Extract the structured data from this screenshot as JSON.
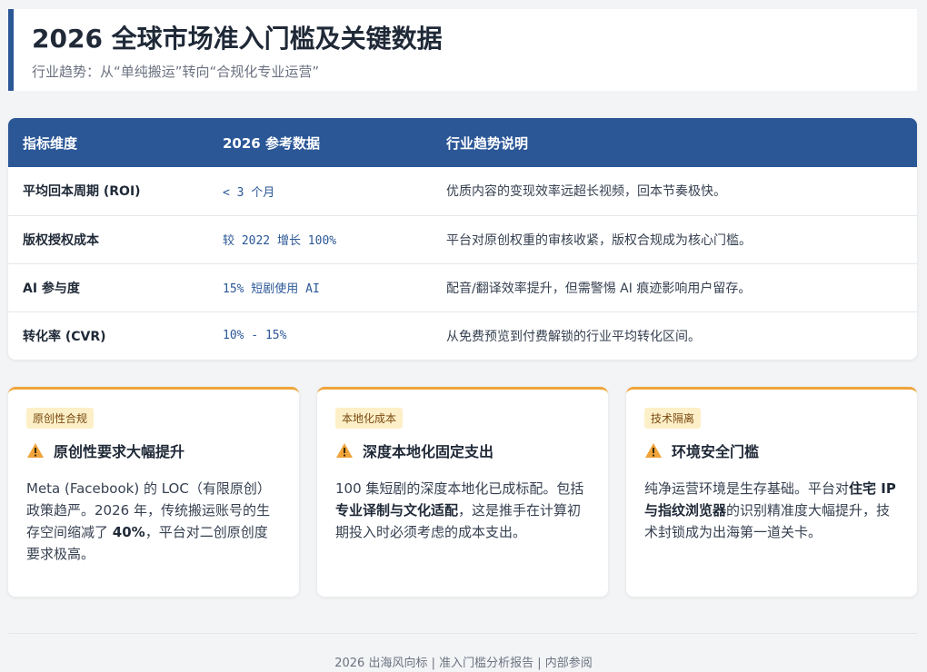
{
  "header": {
    "title": "2026 全球市场准入门槛及关键数据",
    "subtitle": "行业趋势：从“单纯搬运”转向“合规化专业运营”"
  },
  "table": {
    "headers": [
      "指标维度",
      "2026 参考数据",
      "行业趋势说明"
    ],
    "rows": [
      {
        "metric": "平均回本周期 (ROI)",
        "value": "< 3 个月",
        "desc": "优质内容的变现效率远超长视频，回本节奏极快。"
      },
      {
        "metric": "版权授权成本",
        "value": "较 2022 增长 100%",
        "desc": "平台对原创权重的审核收紧，版权合规成为核心门槛。"
      },
      {
        "metric": "AI 参与度",
        "value": "15% 短剧使用 AI",
        "desc": "配音/翻译效率提升，但需警惕 AI 痕迹影响用户留存。"
      },
      {
        "metric": "转化率 (CVR)",
        "value": "10% - 15%",
        "desc": "从免费预览到付费解锁的行业平均转化区间。"
      }
    ]
  },
  "cards": [
    {
      "tag": "原创性合规",
      "title": "原创性要求大幅提升",
      "body": [
        "Meta (Facebook) 的 LOC（有限原创）政策趋严。2026 年，传统搬运账号的生存空间缩减了 ",
        "40%",
        "，平台对二创原创度要求极高。"
      ]
    },
    {
      "tag": "本地化成本",
      "title": "深度本地化固定支出",
      "body": [
        "100 集短剧的深度本地化已成标配。包括",
        "专业译制与文化适配",
        "，这是推手在计算初期投入时必须考虑的成本支出。"
      ]
    },
    {
      "tag": "技术隔离",
      "title": "环境安全门槛",
      "body": [
        "纯净运营环境是生存基础。平台对",
        "住宅 IP 与指纹浏览器",
        "的识别精准度大幅提升，技术封锁成为出海第一道关卡。"
      ]
    }
  ],
  "footer": "2026 出海风向标 | 准入门槛分析报告 | 内部参阅",
  "colors": {
    "primary": "#2b5797",
    "accent": "#f0a43a",
    "tag_bg": "#fdefc7",
    "warning_icon": "#f0a43a"
  },
  "icons": {
    "card_title_icon": "warning-icon"
  }
}
